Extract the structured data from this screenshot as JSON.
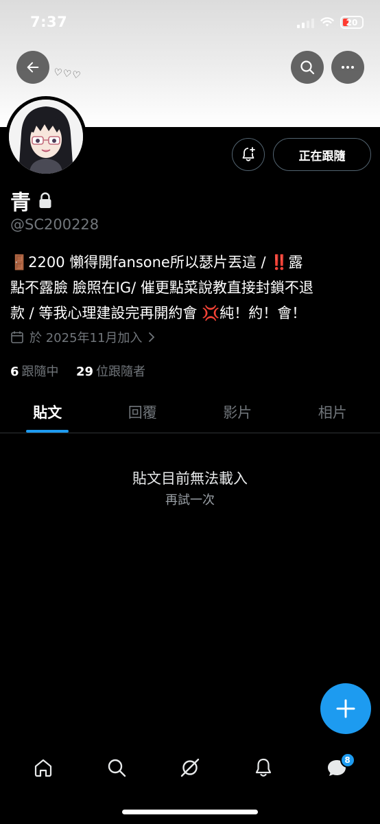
{
  "status_bar": {
    "time": "7:37",
    "battery": "20"
  },
  "banner": {
    "hearts": "♡♡♡"
  },
  "profile": {
    "name": "青",
    "handle": "@SC200228",
    "bio_line1_a": "🚪2200 懶得開fansone所以瑟片丟這 / ",
    "bio_line1_b": "‼️",
    "bio_line1_c": "露",
    "bio_line2": "點不露臉 臉照在IG/ 催更點菜說教直接封鎖不退",
    "bio_line3": "款 / 等我心理建設完再開約會 💢純！約！會！",
    "joined": "於 2025年11月加入",
    "following_count": "6",
    "following_label": "跟隨中",
    "followers_count": "29",
    "followers_label": "位跟隨者"
  },
  "actions": {
    "follow_state": "正在跟隨"
  },
  "tabs": [
    {
      "label": "貼文",
      "active": true
    },
    {
      "label": "回覆",
      "active": false
    },
    {
      "label": "影片",
      "active": false
    },
    {
      "label": "相片",
      "active": false
    }
  ],
  "content": {
    "error_title": "貼文目前無法載入",
    "retry_label": "再試一次"
  },
  "nav": {
    "messages_badge": "8"
  },
  "colors": {
    "accent": "#1d9bf0",
    "muted": "#71767b",
    "background": "#000000"
  },
  "icons": {
    "back": "back-arrow-icon",
    "search": "search-icon",
    "more": "more-icon",
    "notify": "notification-bell-plus-icon",
    "lock": "lock-icon",
    "calendar": "calendar-icon",
    "compose": "plus-icon",
    "home": "home-icon",
    "explore": "search-icon",
    "grok": "grok-icon",
    "notifications": "bell-icon",
    "messages": "chat-bubble-icon"
  }
}
